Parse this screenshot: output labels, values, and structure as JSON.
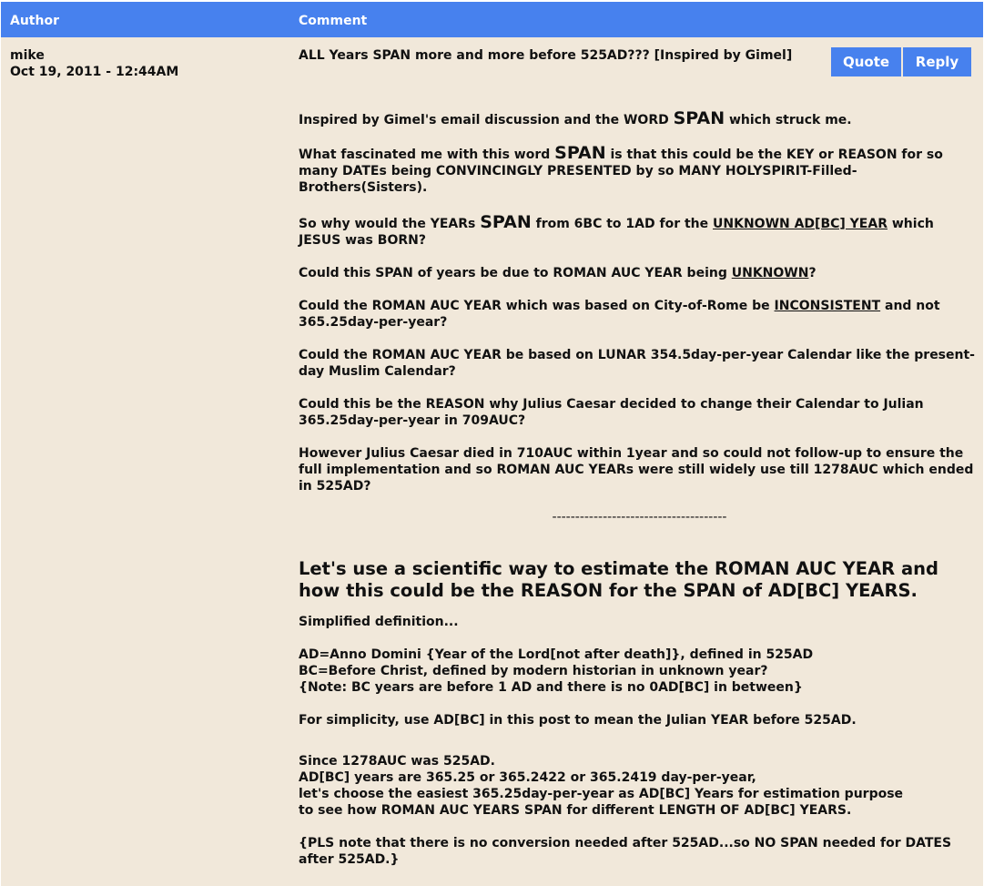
{
  "header": {
    "author_col": "Author",
    "comment_col": "Comment"
  },
  "post": {
    "author": "mike",
    "date": "Oct 19, 2011 - 12:44AM",
    "title": "ALL Years SPAN more and more before 525AD??? [Inspired by Gimel]",
    "actions": {
      "quote": "Quote",
      "reply": "Reply"
    },
    "p1": {
      "a": "Inspired by Gimel's email discussion and the WORD ",
      "big": "SPAN",
      "b": " which struck me."
    },
    "p2": {
      "a": "What fascinated me with this word ",
      "big": "SPAN",
      "b": " is that this could be the KEY or REASON for so many DATEs being CONVINCINGLY PRESENTED by so MANY HOLYSPIRIT-Filled-Brothers(Sisters)."
    },
    "p3": {
      "a": "So why would the YEARs ",
      "big": "SPAN",
      "b": " from 6BC to 1AD for the ",
      "u": "UNKNOWN AD[BC] YEAR",
      "c": " which JESUS was BORN?"
    },
    "p4": {
      "a": "Could this SPAN of years be due to ROMAN AUC YEAR being ",
      "u": "UNKNOWN",
      "b": "?"
    },
    "p5": {
      "a": "Could the ROMAN AUC YEAR which was based on City-of-Rome be ",
      "u": "INCONSISTENT",
      "b": " and not 365.25day-per-year?"
    },
    "p6": "Could the ROMAN AUC YEAR be based on LUNAR 354.5day-per-year Calendar like the present-day Muslim Calendar?",
    "p7": "Could this be the REASON why Julius Caesar decided to change their Calendar to Julian 365.25day-per-year in 709AUC?",
    "p8": "However Julius Caesar died in 710AUC within 1year and so could not follow-up to ensure the full implementation and so ROMAN AUC YEARs were still widely use till 1278AUC which ended in 525AD?",
    "separator": "--------------------------------------",
    "heading": "Let's use a scientific way to estimate the ROMAN AUC YEAR and how this could be the REASON for the SPAN of AD[BC] YEARS.",
    "def_title": "Simplified definition...",
    "def_lines": [
      "AD=Anno Domini {Year of the Lord[not after death]}, defined in 525AD",
      "BC=Before Christ, defined by modern historian in unknown year?",
      "{Note: BC years are before 1 AD and there is no 0AD[BC] in between}"
    ],
    "simplicity": "For simplicity, use AD[BC] in this post to mean the Julian YEAR before 525AD.",
    "since_lines": [
      "Since 1278AUC was 525AD.",
      "AD[BC] years are 365.25 or 365.2422 or 365.2419 day-per-year,",
      "let's choose the easiest 365.25day-per-year as AD[BC] Years for estimation purpose",
      "to see how ROMAN AUC YEARS SPAN for different LENGTH OF AD[BC] YEARS."
    ],
    "note": "{PLS note that there is no conversion needed after 525AD...so NO SPAN needed for DATES after 525AD.}"
  }
}
